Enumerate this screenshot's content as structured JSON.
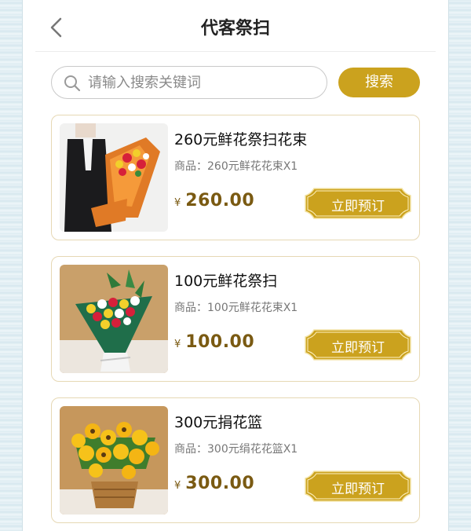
{
  "header": {
    "title": "代客祭扫",
    "back_icon": "chevron-left-icon"
  },
  "search": {
    "placeholder": "请输入搜索关键词",
    "button_label": "搜索",
    "icon": "search-icon"
  },
  "colors": {
    "accent": "#cba21e",
    "price": "#7a5a12",
    "card_border": "#e6d8b4"
  },
  "products": [
    {
      "name": "260元鲜花祭扫花束",
      "desc": "商品：260元鲜花花束X1",
      "currency": "¥",
      "price": "260.00",
      "button": "立即预订"
    },
    {
      "name": "100元鲜花祭扫",
      "desc": "商品：100元鲜花花束X1",
      "currency": "¥",
      "price": "100.00",
      "button": "立即预订"
    },
    {
      "name": "300元捐花篮",
      "desc": "商品：300元绢花花篮X1",
      "currency": "¥",
      "price": "300.00",
      "button": "立即预订"
    }
  ]
}
